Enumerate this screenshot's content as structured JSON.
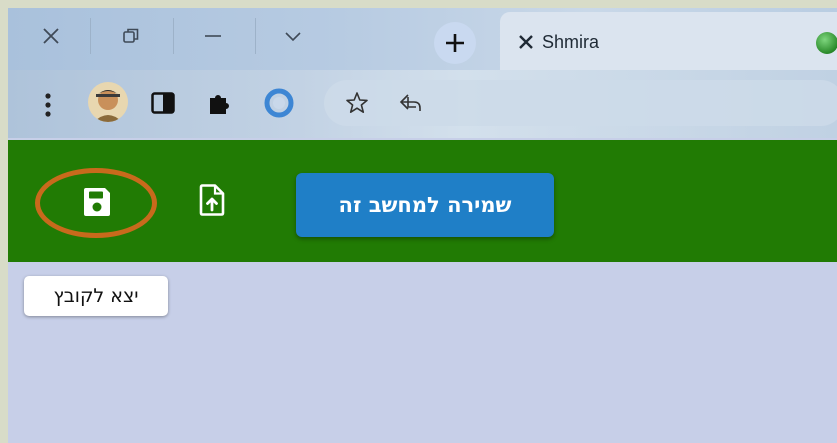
{
  "window": {
    "controls": [
      {
        "name": "close-icon"
      },
      {
        "name": "restore-icon"
      },
      {
        "name": "minimize-icon"
      },
      {
        "name": "chevron-down-icon"
      }
    ]
  },
  "tab": {
    "title": "Shmira",
    "close_icon": "close-icon",
    "favicon": "shield-icon"
  },
  "toolbar": {
    "icons": [
      "more-vert-icon",
      "avatar",
      "sidebar-icon",
      "puzzle-icon",
      "edge-icon",
      "star-icon",
      "share-icon"
    ]
  },
  "appbar": {
    "background_color": "#217b04",
    "save_icon": "floppy-disk-icon",
    "export_icon": "file-upload-icon",
    "save_local_label": "שמירה למחשב זה",
    "save_local_color": "#1f7fc7",
    "highlight_color": "#c86a1c"
  },
  "tooltip": {
    "text": "יצא לקובץ"
  }
}
